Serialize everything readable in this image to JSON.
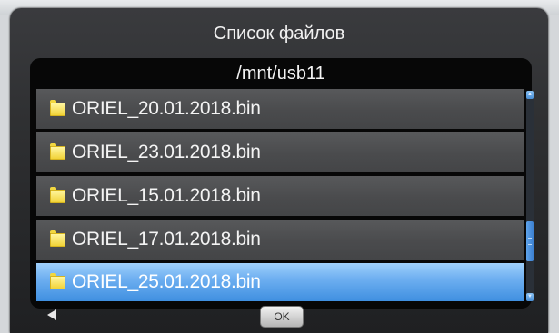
{
  "dialog": {
    "title": "Список файлов",
    "path": "/mnt/usb11"
  },
  "files": [
    {
      "name": "ORIEL_20.01.2018.bin",
      "selected": false
    },
    {
      "name": "ORIEL_23.01.2018.bin",
      "selected": false
    },
    {
      "name": "ORIEL_15.01.2018.bin",
      "selected": false
    },
    {
      "name": "ORIEL_17.01.2018.bin",
      "selected": false
    },
    {
      "name": "ORIEL_25.01.2018.bin",
      "selected": true
    }
  ],
  "icons": {
    "file": "folder-icon",
    "scroll_up": "arrow-up-icon",
    "scroll_down": "arrow-down-icon",
    "nav": "arrow-left-icon"
  },
  "scroll": {
    "position_fraction": 0.68
  },
  "footer": {
    "ok_label": "OK"
  },
  "colors": {
    "selection": "#4a96e6",
    "row": "#4d4e50",
    "panel": "#070707",
    "folder": "#f1d338"
  }
}
